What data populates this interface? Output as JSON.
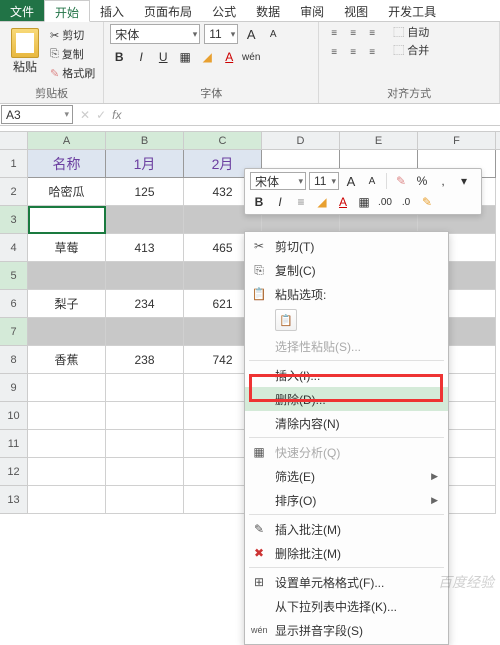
{
  "tabs": {
    "file": "文件",
    "home": "开始",
    "insert": "插入",
    "layout": "页面布局",
    "formula": "公式",
    "data": "数据",
    "review": "审阅",
    "view": "视图",
    "dev": "开发工具"
  },
  "ribbon": {
    "clipboard": {
      "paste": "粘贴",
      "cut": "剪切",
      "copy": "复制",
      "format_painter": "格式刷",
      "label": "剪贴板"
    },
    "font": {
      "name": "宋体",
      "size": "11",
      "label": "字体",
      "B": "B",
      "I": "I",
      "U": "U"
    },
    "align": {
      "label": "对齐方式",
      "wrap": "自动",
      "merge": "合并"
    }
  },
  "namebox": "A3",
  "fx": "fx",
  "cols": [
    "A",
    "B",
    "C",
    "D",
    "E",
    "F"
  ],
  "rows": [
    "1",
    "2",
    "3",
    "4",
    "5",
    "6",
    "7",
    "8",
    "9",
    "10",
    "11",
    "12",
    "13"
  ],
  "sheet": {
    "header": [
      "名称",
      "1月",
      "2月"
    ],
    "r2": [
      "哈密瓜",
      "125",
      "432"
    ],
    "r4": [
      "草莓",
      "413",
      "465"
    ],
    "r6": [
      "梨子",
      "234",
      "621"
    ],
    "r8": [
      "香蕉",
      "238",
      "742"
    ]
  },
  "mini": {
    "font": "宋体",
    "size": "11"
  },
  "menu": {
    "cut": "剪切(T)",
    "copy": "复制(C)",
    "paste_opts": "粘贴选项:",
    "paste_special": "选择性粘贴(S)...",
    "insert": "插入(I)...",
    "delete": "删除(D)...",
    "clear": "清除内容(N)",
    "quick": "快速分析(Q)",
    "filter": "筛选(E)",
    "sort": "排序(O)",
    "insert_comment": "插入批注(M)",
    "delete_comment": "删除批注(M)",
    "format_cells": "设置单元格格式(F)...",
    "dropdown": "从下拉列表中选择(K)...",
    "pinyin": "显示拼音字段(S)"
  },
  "watermark": "百度经验"
}
